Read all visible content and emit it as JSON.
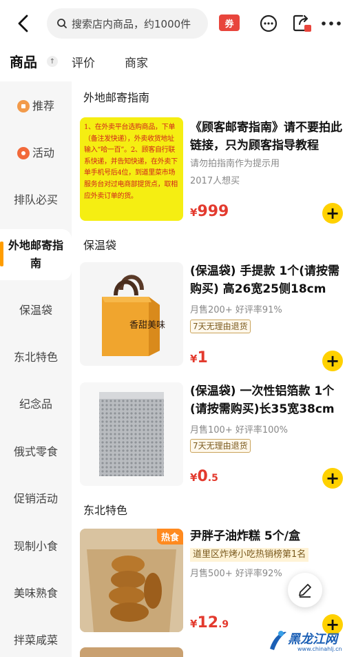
{
  "search": {
    "placeholder": "搜索店内商品，约1000件"
  },
  "top_icons": {
    "coupon_label": "券"
  },
  "tabs": {
    "goods": "商品",
    "goods_badge": "↑",
    "reviews": "评价",
    "merchant": "商家"
  },
  "sidebar": {
    "items": [
      {
        "label": "推荐",
        "icon": "recommend-icon",
        "icon_color": "#f29a4a"
      },
      {
        "label": "活动",
        "icon": "activity-icon",
        "icon_color": "#f2693a"
      },
      {
        "label": "排队必买"
      },
      {
        "label": "外地邮寄指南",
        "active": true
      },
      {
        "label": "保温袋"
      },
      {
        "label": "东北特色"
      },
      {
        "label": "纪念品"
      },
      {
        "label": "俄式零食"
      },
      {
        "label": "促销活动"
      },
      {
        "label": "现制小食"
      },
      {
        "label": "美味熟食"
      },
      {
        "label": "拌菜咸菜"
      }
    ]
  },
  "sections": {
    "s1": "外地邮寄指南",
    "s2": "保温袋",
    "s3": "东北特色"
  },
  "guide_image_text": "1、在外卖平台选购商品，下单（备注发快递），外卖收货地址输入“哈一百”。2、顾客自行联系快递，并告知快递，在外卖下单手机号后4位，到道里菜市场服务台对过电商部提货点，取相应外卖订单的货。",
  "products": [
    {
      "title": "《顾客邮寄指南》请不要拍此链接，只为顾客指导教程",
      "sub1": "请勿拍指南作为提示用",
      "sub2": "2017人想买",
      "price_cur": "¥",
      "price_int": "999",
      "price_dec": ""
    },
    {
      "title": "(保温袋) 手提款 1个(请按需购买) 高26宽25侧18cm",
      "sub1": "月售200+   好评率91%",
      "tag": "7天无理由退货",
      "price_cur": "¥",
      "price_int": "1",
      "price_dec": ""
    },
    {
      "title": "(保温袋) 一次性铝箔款 1个(请按需购买)长35宽38cm",
      "sub1": "月售100+   好评率100%",
      "tag": "7天无理由退货",
      "price_cur": "¥",
      "price_int": "0",
      "price_dec": ".5"
    },
    {
      "title": "尹胖子油炸糕 5个/盒",
      "rank": "道里区炸烤小吃热销榜第1名",
      "sub1": "月售500+   好评率92%",
      "badge": "热食",
      "price_cur": "¥",
      "price_int": "12",
      "price_dec": ".9"
    }
  ],
  "bag_print": "香甜美味",
  "add_symbol": "+",
  "watermark": {
    "text": "黑龙江网",
    "url": "www.chinahlj.cn"
  },
  "colors": {
    "accent": "#ffd100",
    "price": "#e33a2e",
    "active_bar": "#ff9d00"
  }
}
